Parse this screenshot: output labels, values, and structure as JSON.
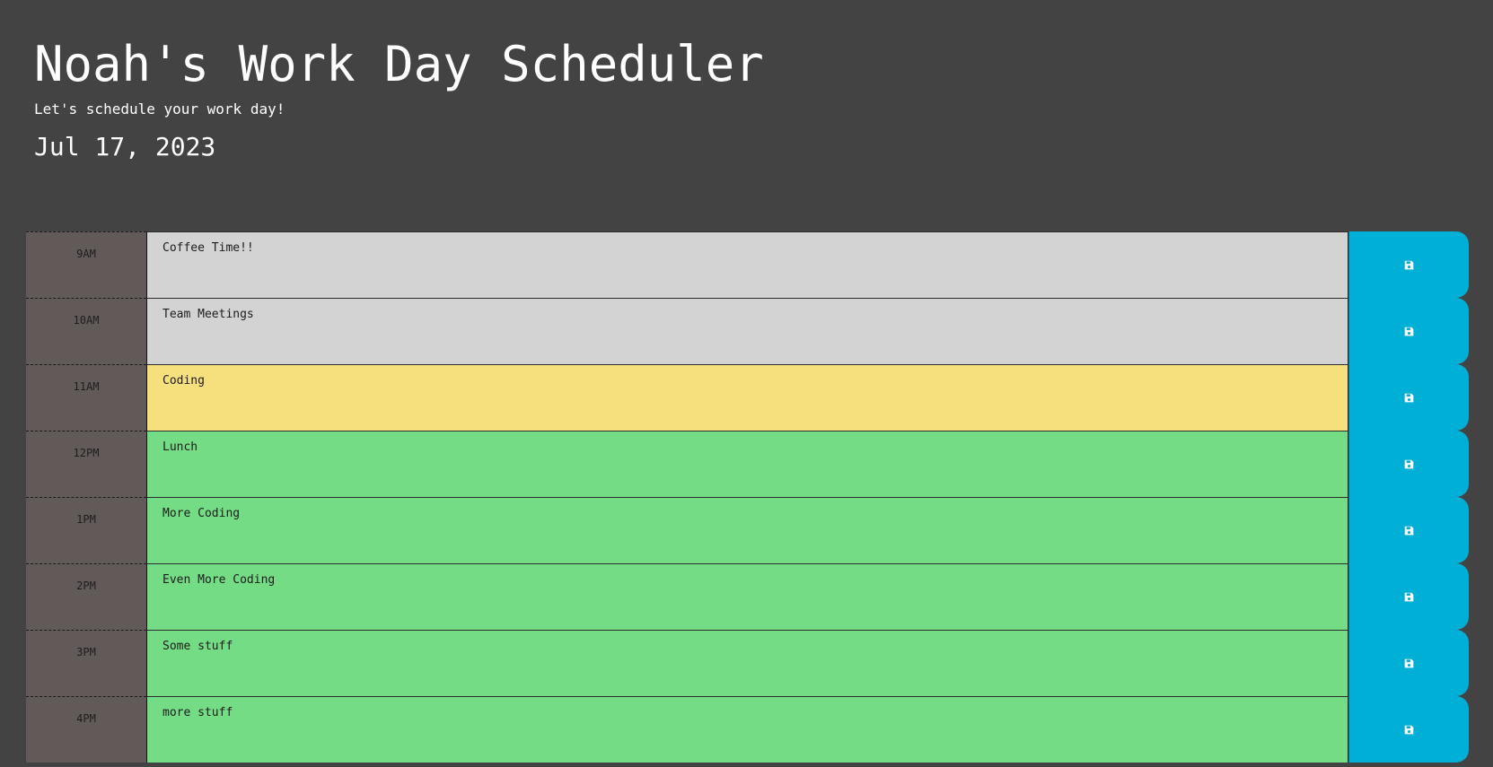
{
  "header": {
    "title": "Noah's Work Day Scheduler",
    "subtitle": "Let's schedule your work day!",
    "date": "Jul 17, 2023"
  },
  "colors": {
    "background": "#434343",
    "past": "#d3d3d3",
    "present": "#f6df7d",
    "future": "#75dc86",
    "hour_cell": "#625a58",
    "save_button": "#00afd6"
  },
  "rows": [
    {
      "hour": "9AM",
      "text": "Coffee Time!!",
      "state": "past",
      "icon": "save-icon"
    },
    {
      "hour": "10AM",
      "text": "Team Meetings",
      "state": "past",
      "icon": "save-icon"
    },
    {
      "hour": "11AM",
      "text": "Coding",
      "state": "present",
      "icon": "save-icon"
    },
    {
      "hour": "12PM",
      "text": "Lunch",
      "state": "future",
      "icon": "save-icon"
    },
    {
      "hour": "1PM",
      "text": "More Coding",
      "state": "future",
      "icon": "save-icon"
    },
    {
      "hour": "2PM",
      "text": "Even More Coding",
      "state": "future",
      "icon": "save-icon"
    },
    {
      "hour": "3PM",
      "text": "Some stuff",
      "state": "future",
      "icon": "save-icon"
    },
    {
      "hour": "4PM",
      "text": "more stuff",
      "state": "future",
      "icon": "save-icon"
    }
  ]
}
